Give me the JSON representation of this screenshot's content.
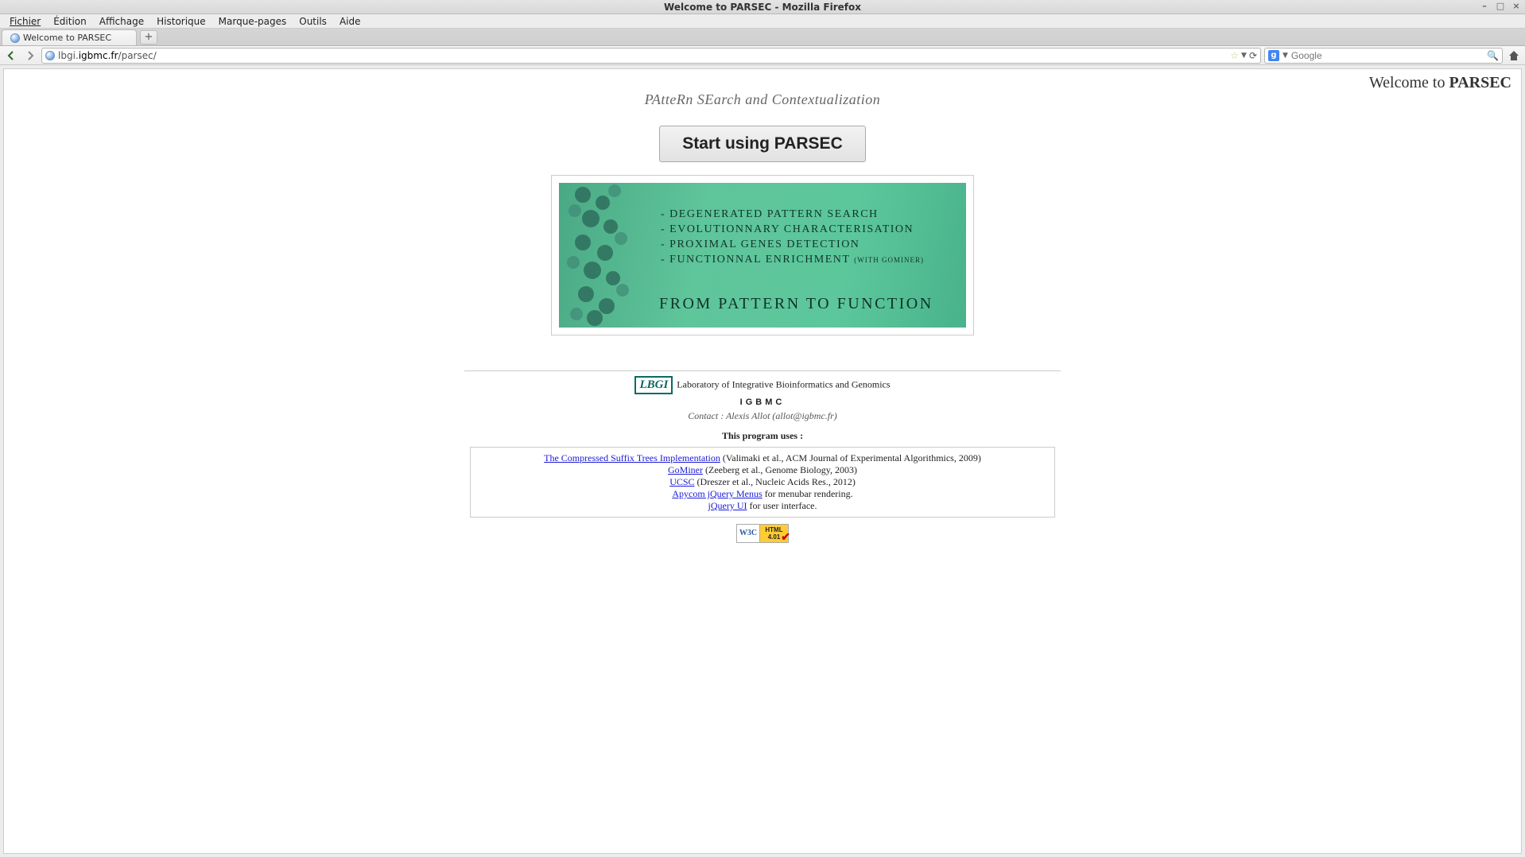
{
  "window": {
    "title": "Welcome to PARSEC - Mozilla Firefox"
  },
  "menubar": {
    "items": [
      "Fichier",
      "Édition",
      "Affichage",
      "Historique",
      "Marque-pages",
      "Outils",
      "Aide"
    ]
  },
  "tab": {
    "title": "Welcome to PARSEC"
  },
  "url": {
    "prefix": "lbgi.",
    "domain": "igbmc.fr",
    "path": "/parsec/"
  },
  "search": {
    "placeholder": "Google"
  },
  "page": {
    "header_prefix": "Welcome to ",
    "header_bold": "PARSEC",
    "tagline": "PAtteRn SEarch and Contextualization",
    "start_button": "Start using PARSEC",
    "banner": {
      "features": [
        "- DEGENERATED PATTERN SEARCH",
        "- EVOLUTIONNARY CHARACTERISATION",
        "- PROXIMAL GENES DETECTION",
        "- FUNCTIONNAL ENRICHMENT"
      ],
      "feature_suffix": "(WITH GOMINER)",
      "main": "FROM PATTERN TO FUNCTION"
    },
    "footer": {
      "lbgi": "LBGI",
      "lab_name": "Laboratory of Integrative Bioinformatics and Genomics",
      "igbmc": "IGBMC",
      "contact": "Contact : Alexis Allot (allot@igbmc.fr)",
      "uses_label": "This program uses :",
      "refs": [
        {
          "link": "The Compressed Suffix Trees Implementation",
          "rest": " (Valimaki et al., ACM Journal of Experimental Algorithmics, 2009)"
        },
        {
          "link": "GoMiner",
          "rest": " (Zeeberg et al., Genome Biology, 2003)"
        },
        {
          "link": "UCSC",
          "rest": " (Dreszer et al., Nucleic Acids Res., 2012)"
        },
        {
          "link": "Apycom jQuery Menus",
          "rest": " for menubar rendering."
        },
        {
          "link": "jQuery UI",
          "rest": " for user interface."
        }
      ],
      "w3c_left": "W3C",
      "w3c_right_line1": "HTML",
      "w3c_right_line2": "4.01"
    }
  }
}
